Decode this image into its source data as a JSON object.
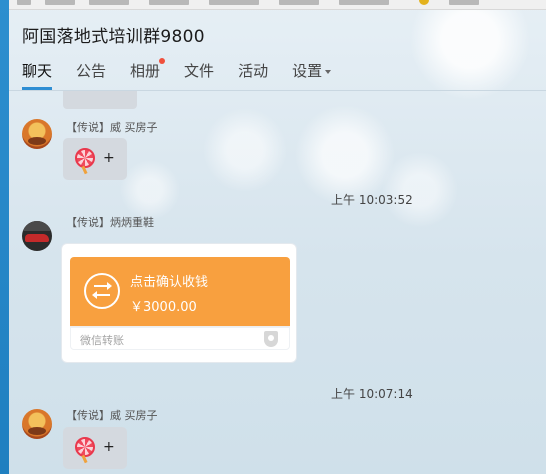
{
  "window": {
    "title": "阿国落地式培训群9800"
  },
  "tabs": [
    {
      "label": "聊天",
      "active": true
    },
    {
      "label": "公告"
    },
    {
      "label": "相册",
      "has_dot": true
    },
    {
      "label": "文件"
    },
    {
      "label": "活动"
    },
    {
      "label": "设置",
      "has_dropdown": true
    }
  ],
  "colors": {
    "accent": "#2e8ed3",
    "transfer_orange": "#f8a03f",
    "bubble_grey": "#d4d9df",
    "notification_dot": "#f0503c"
  },
  "messages": [
    {
      "sender": "【传说】威 买房子",
      "avatar_icon": "avatar-icon",
      "content_icon": "lollipop-icon",
      "content_suffix": "+"
    },
    {
      "timestamp": "上午 10:03:52"
    },
    {
      "sender": "【传说】炳炳重鞋",
      "avatar_icon": "car-avatar-icon",
      "transfer": {
        "label": "点击确认收钱",
        "amount": "￥3000.00",
        "source": "微信转账",
        "icon": "transfer-arrows-icon"
      }
    },
    {
      "timestamp": "上午 10:07:14"
    },
    {
      "sender": "【传说】威 买房子",
      "avatar_icon": "avatar-icon",
      "content_icon": "lollipop-icon",
      "content_suffix": "+"
    }
  ]
}
